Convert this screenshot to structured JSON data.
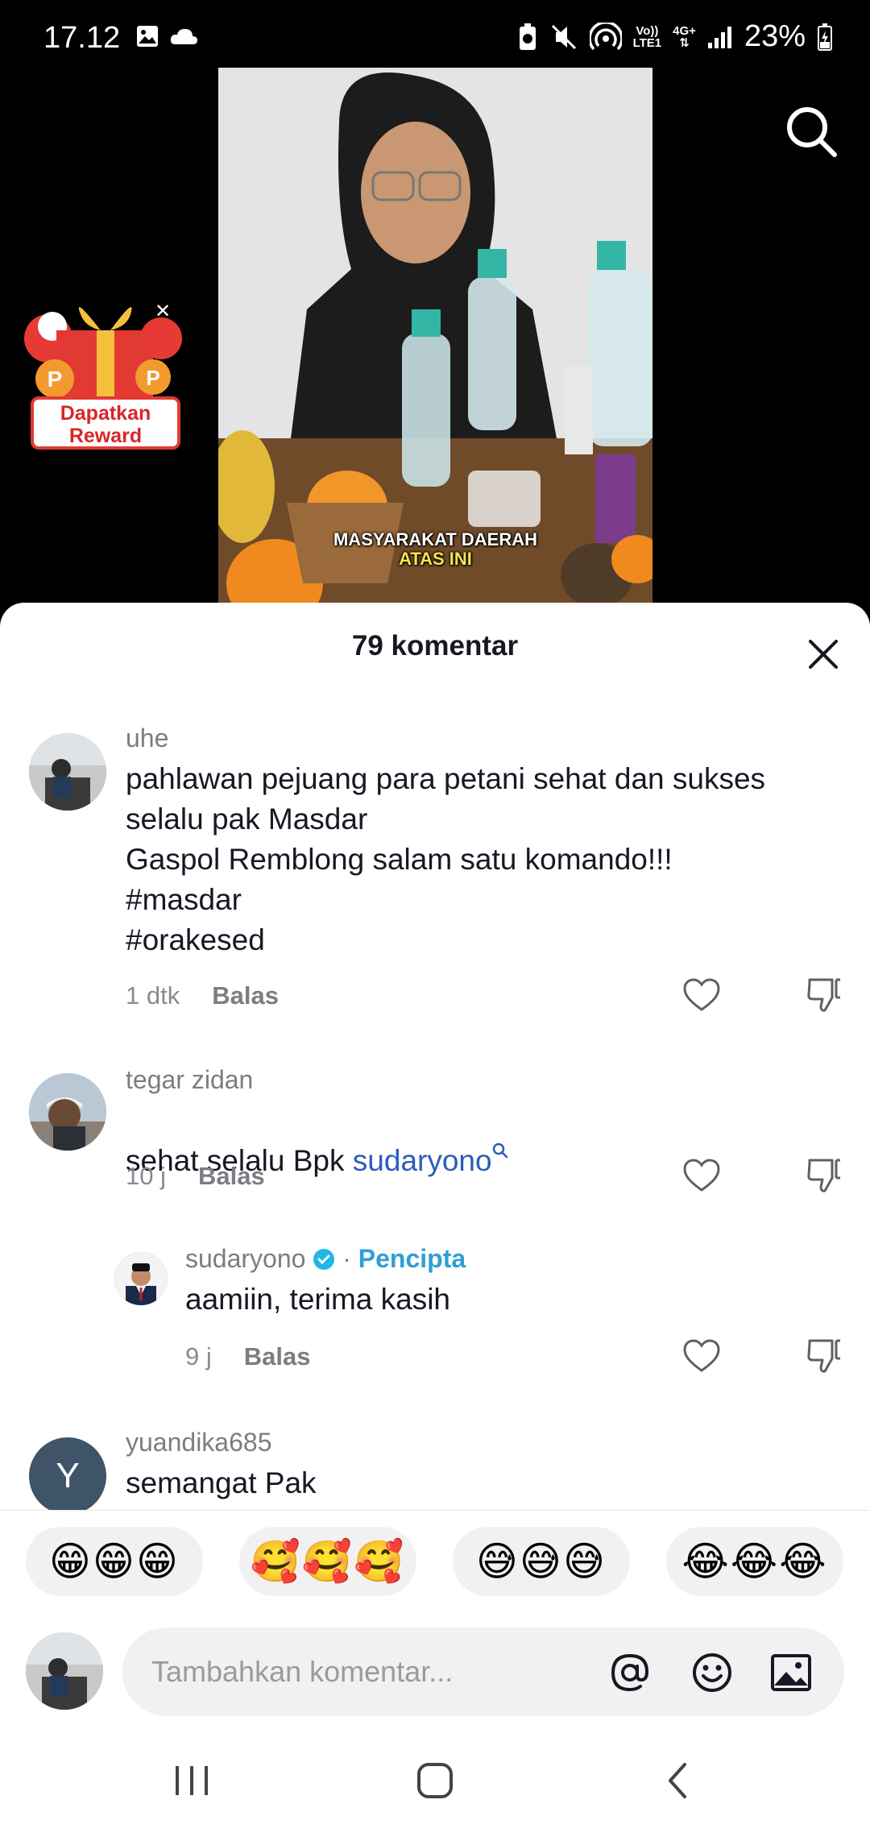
{
  "status_bar": {
    "time": "17.12",
    "network_top": "Vo))",
    "network_bottom": "LTE1",
    "signal_type": "4G+",
    "battery": "23%"
  },
  "video": {
    "caption_line1": "MASYARAKAT DAERAH",
    "caption_line2": "ATAS INI"
  },
  "reward": {
    "line1": "Dapatkan",
    "line2": "Reward"
  },
  "sheet": {
    "title": "79 komentar"
  },
  "comments": [
    {
      "username": "uhe",
      "text": "pahlawan pejuang para petani sehat dan sukses\nselalu pak Masdar\nGaspol Remblong salam satu komando!!!\n#masdar\n#orakesed",
      "time": "1 dtk",
      "reply_label": "Balas"
    },
    {
      "username": "tegar zidan",
      "text_prefix": "sehat selalu Bpk ",
      "mention": "sudaryono",
      "time": "10 j",
      "reply_label": "Balas"
    },
    {
      "username": "sudaryono",
      "creator_badge": "Pencipta",
      "text": "aamiin, terima kasih",
      "time": "9 j",
      "reply_label": "Balas"
    },
    {
      "username": "yuandika685",
      "avatar_letter": "Y",
      "text": "semangat Pak"
    }
  ],
  "emoji_suggestions": [
    "😁😁😁",
    "🥰🥰🥰",
    "😅😅😅",
    "😂😂😂"
  ],
  "input": {
    "placeholder": "Tambahkan komentar..."
  },
  "icons": {
    "search": "search-icon",
    "close": "close-icon",
    "heart": "heart-icon",
    "dislike": "dislike-icon",
    "mention": "at-icon",
    "emoji": "emoji-icon",
    "image": "image-icon",
    "verified": "verified-icon"
  },
  "colors": {
    "mention": "#2b5db9",
    "creator": "#2f9fd6",
    "verified": "#20b7e6"
  }
}
